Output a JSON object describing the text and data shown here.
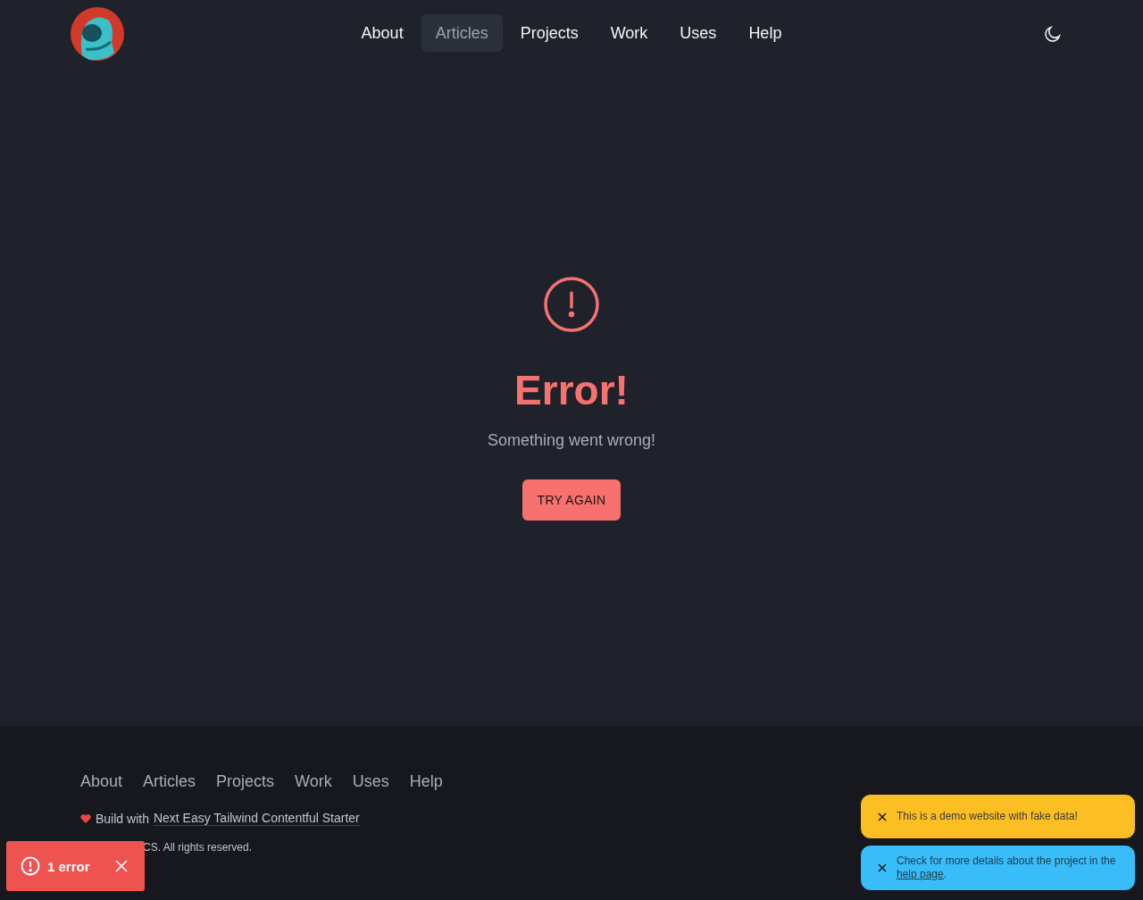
{
  "header": {
    "nav": [
      {
        "label": "About",
        "selected": false
      },
      {
        "label": "Articles",
        "selected": true
      },
      {
        "label": "Projects",
        "selected": false
      },
      {
        "label": "Work",
        "selected": false
      },
      {
        "label": "Uses",
        "selected": false
      },
      {
        "label": "Help",
        "selected": false
      }
    ]
  },
  "error": {
    "title": "Error!",
    "message": "Something went wrong!",
    "button": "TRY AGAIN"
  },
  "footer": {
    "nav": [
      "About",
      "Articles",
      "Projects",
      "Work",
      "Uses",
      "Help"
    ],
    "credit": {
      "text": "Build with",
      "link": "Next Easy Tailwind Contentful Starter"
    },
    "copyright": "CS. All rights reserved."
  },
  "toasts": [
    {
      "kind": "warning",
      "color": "#fbbf24",
      "text": "This is a demo website with fake data!"
    },
    {
      "kind": "info",
      "color": "#38bdf8",
      "text": "Check for more details about the project in the",
      "link": "help page",
      "after": "."
    }
  ],
  "error_badge": {
    "label": "1 error"
  }
}
